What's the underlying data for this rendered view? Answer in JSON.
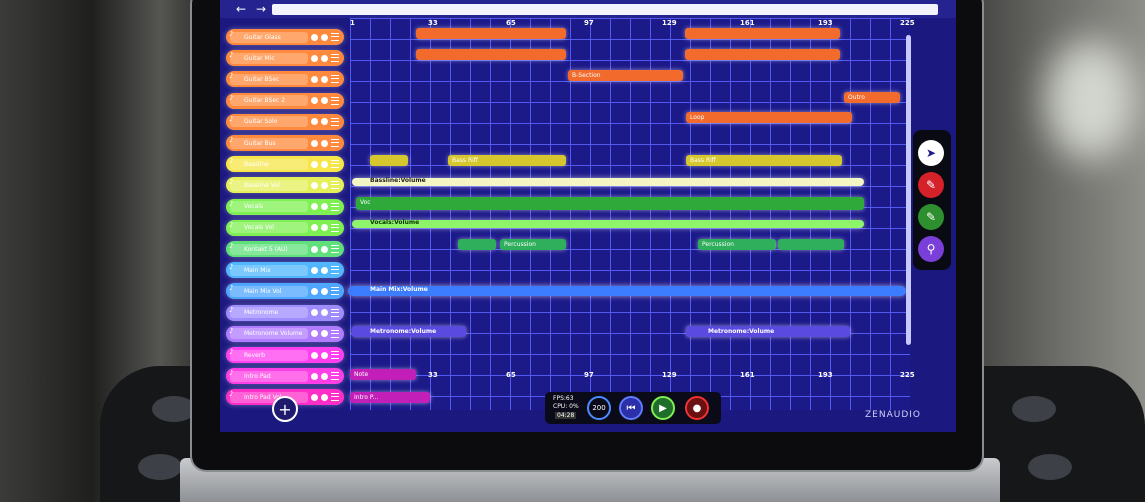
{
  "tracks": [
    {
      "label": "Guitar Glass",
      "color": "#ff8a3d"
    },
    {
      "label": "Guitar Mic",
      "color": "#ff8a3d"
    },
    {
      "label": "Guitar BSec",
      "color": "#ff8a3d"
    },
    {
      "label": "Guitar BSec 2",
      "color": "#ff8a3d"
    },
    {
      "label": "Guitar Solo",
      "color": "#ff8a3d"
    },
    {
      "label": "Guitar Bus",
      "color": "#ff8a3d"
    },
    {
      "label": "Bassline",
      "color": "#f6e64a"
    },
    {
      "label": "Bassline Vol",
      "color": "#e4ef5a"
    },
    {
      "label": "Vocals",
      "color": "#7ff052"
    },
    {
      "label": "Vocals Vol",
      "color": "#7ff052"
    },
    {
      "label": "Kontakt 5 (AU)",
      "color": "#5fe07b"
    },
    {
      "label": "Main Mix",
      "color": "#4fb6ff"
    },
    {
      "label": "Main Mix Vol",
      "color": "#4fa6ff"
    },
    {
      "label": "Metronome",
      "color": "#9f8cff"
    },
    {
      "label": "Metronome Volume",
      "color": "#b17bff"
    },
    {
      "label": "Reverb",
      "color": "#ff3ff0"
    },
    {
      "label": "Intro Pad",
      "color": "#ff3fe6"
    },
    {
      "label": "Intro Pad Vol",
      "color": "#ff2ec8"
    }
  ],
  "ruler_top": [
    "1",
    "33",
    "65",
    "97",
    "129",
    "161",
    "193",
    "225"
  ],
  "ruler_bottom": [
    "1",
    "33",
    "65",
    "97",
    "129",
    "161",
    "193",
    "225"
  ],
  "clips": {
    "bsection": "B-Section",
    "outro": "Outro",
    "loop": "Loop",
    "bass_riff_1": "Bass Riff",
    "bass_riff_2": "Bass Riff",
    "vocals_clip": "Voc",
    "percussion_1": "Percussion",
    "percussion_2": "Percussion",
    "note": "Note",
    "intro_p": "Intro P..."
  },
  "automation": {
    "bassline_volume": "Bassline:Volume",
    "vocals_volume": "Vocals:Volume",
    "main_mix_volume": "Main Mix:Volume",
    "metronome_volume_1": "Metronome:Volume",
    "metronome_volume_2": "Metronome:Volume"
  },
  "transport": {
    "fps": "FPS:63",
    "cpu": "CPU: 0%",
    "time": "04:28",
    "tempo": "200"
  },
  "logo": "ZENAUDIO",
  "tools": [
    "pointer-icon",
    "pencil-red-icon",
    "pencil-green-icon",
    "zoom-icon"
  ],
  "colors": {
    "background": "#1d1a8a",
    "grid": "#5a62ff",
    "accent_orange": "#ff8a3d",
    "accent_green": "#7ff052",
    "accent_blue": "#4fb6ff",
    "accent_pink": "#ff3ff0"
  }
}
